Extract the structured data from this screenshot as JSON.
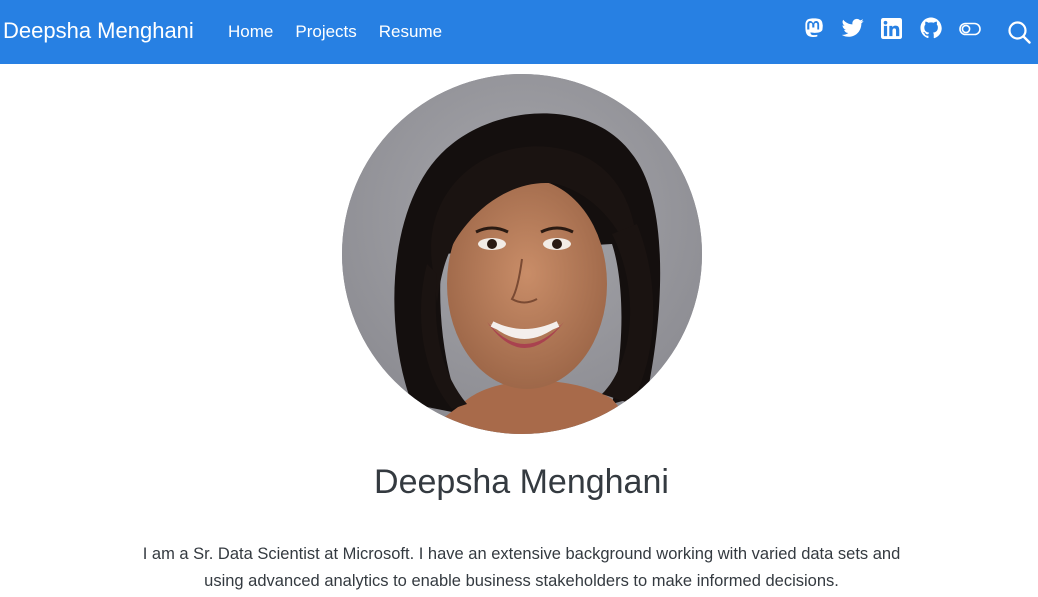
{
  "navbar": {
    "brand": "Deepsha Menghani",
    "links": [
      {
        "label": "Home"
      },
      {
        "label": "Projects"
      },
      {
        "label": "Resume"
      }
    ],
    "icons": [
      "mastodon-icon",
      "twitter-icon",
      "linkedin-icon",
      "github-icon",
      "toggle-icon",
      "search-icon"
    ],
    "background_color": "#2780e3"
  },
  "profile": {
    "name": "Deepsha Menghani",
    "bio_line_1": "I am a Sr. Data Scientist at Microsoft. I have an extensive background working with varied data sets and",
    "bio_line_2": "using advanced analytics to enable business stakeholders to make informed decisions."
  }
}
